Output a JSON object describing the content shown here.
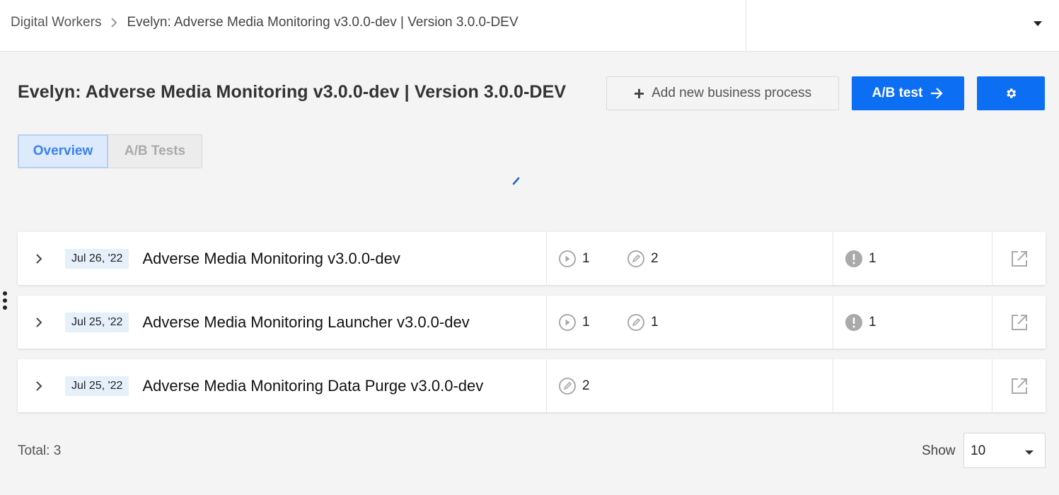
{
  "breadcrumb": {
    "root": "Digital Workers",
    "current": "Evelyn: Adverse Media Monitoring v3.0.0-dev | Version 3.0.0-DEV"
  },
  "header": {
    "title": "Evelyn: Adverse Media Monitoring v3.0.0-dev | Version 3.0.0-DEV",
    "add_process_label": "Add new business process",
    "ab_test_label": "A/B test"
  },
  "tabs": [
    {
      "label": "Overview",
      "active": true
    },
    {
      "label": "A/B Tests",
      "active": false
    }
  ],
  "processes": [
    {
      "date": "Jul 26, '22",
      "name": "Adverse Media Monitoring v3.0.0-dev",
      "runs": "1",
      "edits": "2",
      "issues": "1"
    },
    {
      "date": "Jul 25, '22",
      "name": "Adverse Media Monitoring Launcher v3.0.0-dev",
      "runs": "1",
      "edits": "1",
      "issues": "1"
    },
    {
      "date": "Jul 25, '22",
      "name": "Adverse Media Monitoring Data Purge v3.0.0-dev",
      "runs": "",
      "edits": "2",
      "issues": ""
    }
  ],
  "footer": {
    "total": "Total: 3",
    "show_label": "Show",
    "page_size": "10"
  },
  "colors": {
    "primary": "#0c6ef2",
    "tab_active_bg": "#ddeafc",
    "tab_active_text": "#3b82e6",
    "badge_bg": "#e6f0fb",
    "icon_gray": "#aaaaaa"
  },
  "icons": [
    "chevron-right-icon",
    "plus-icon",
    "arrow-right-icon",
    "gear-icon",
    "play-circle-icon",
    "pencil-circle-icon",
    "alert-circle-icon",
    "open-external-icon",
    "more-vertical-icon",
    "loading-spinner-icon"
  ]
}
